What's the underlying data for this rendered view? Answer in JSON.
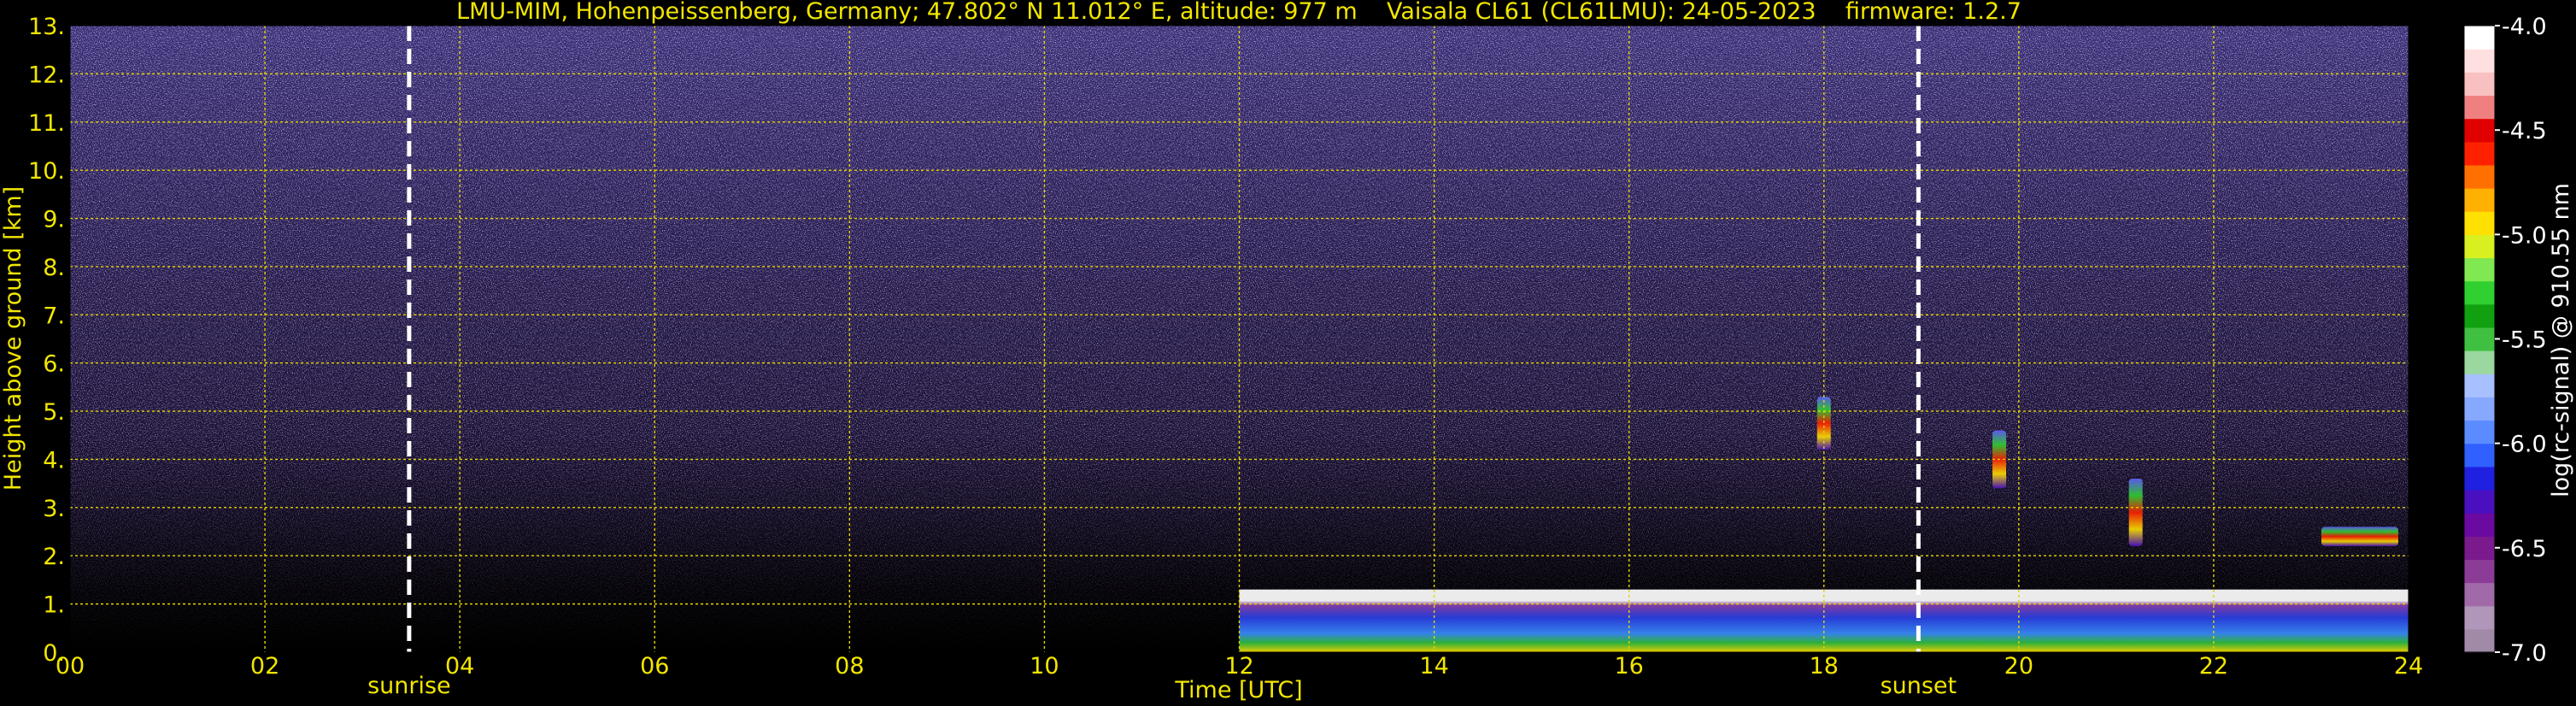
{
  "chart_data": {
    "type": "heatmap",
    "title": "LMU-MIM, Hohenpeissenberg, Germany; 47.802° N 11.012° E, altitude: 977 m    Vaisala CL61 (CL61LMU): 24-05-2023    firmware: 1.2.7",
    "xlabel": "Time [UTC]",
    "ylabel": "Height above ground [km]",
    "xlim": [
      0,
      24
    ],
    "ylim": [
      0,
      13
    ],
    "x_ticks": [
      "00",
      "02",
      "04",
      "06",
      "08",
      "10",
      "12",
      "14",
      "16",
      "18",
      "20",
      "22",
      "24"
    ],
    "x_tick_values": [
      0,
      2,
      4,
      6,
      8,
      10,
      12,
      14,
      16,
      18,
      20,
      22,
      24
    ],
    "y_ticks": [
      "0.",
      "1.",
      "2.",
      "3.",
      "4.",
      "5.",
      "6.",
      "7.",
      "8.",
      "9.",
      "10.",
      "11.",
      "12.",
      "13."
    ],
    "y_tick_values": [
      0,
      1,
      2,
      3,
      4,
      5,
      6,
      7,
      8,
      9,
      10,
      11,
      12,
      13
    ],
    "grid": true,
    "markers": [
      {
        "label": "sunrise",
        "x": 3.48
      },
      {
        "label": "sunset",
        "x": 18.97
      }
    ],
    "colorbar": {
      "label": "log(rc-signal) @ 910.55 nm",
      "range": [
        -7.0,
        -4.0
      ],
      "ticks": [
        "-4.0",
        "-4.5",
        "-5.0",
        "-5.5",
        "-6.0",
        "-6.5",
        "-7.0"
      ],
      "tick_values": [
        -4.0,
        -4.5,
        -5.0,
        -5.5,
        -6.0,
        -6.5,
        -7.0
      ],
      "colors": [
        "#a08aa8",
        "#b096b8",
        "#a06aa8",
        "#8c3c96",
        "#7a1a8c",
        "#6a0aa0",
        "#4a10c0",
        "#2020e0",
        "#3060ff",
        "#5a8cff",
        "#86a8ff",
        "#a8c0ff",
        "#9ad8a0",
        "#40c040",
        "#10a010",
        "#30d030",
        "#80e850",
        "#d8f020",
        "#ffe000",
        "#ffb000",
        "#ff7000",
        "#ff2000",
        "#e00000",
        "#f08080",
        "#f8c0c0",
        "#ffe0e0",
        "#ffffff"
      ]
    },
    "features": [
      {
        "name": "boundary layer",
        "t_start": 12.0,
        "t_end": 24.0,
        "z_top": 1.3
      },
      {
        "name": "cloud 18h",
        "t": 18.0,
        "z_bottom": 4.2,
        "z_top": 5.3
      },
      {
        "name": "cloud 19.8h",
        "t": 19.8,
        "z_bottom": 3.4,
        "z_top": 4.6
      },
      {
        "name": "cloud 21.2h",
        "t": 21.2,
        "z_bottom": 2.2,
        "z_top": 3.6
      },
      {
        "name": "layer 23.5h",
        "t": 23.5,
        "z_bottom": 2.2,
        "z_top": 2.6
      }
    ]
  }
}
